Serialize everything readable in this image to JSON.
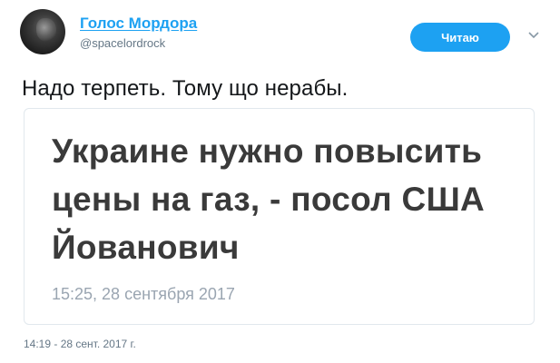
{
  "author": {
    "name": "Голос Мордора",
    "handle": "@spacelordrock"
  },
  "follow_button": {
    "label": "Читаю"
  },
  "tweet": {
    "text": "Надо терпеть. Тому що нерабы.",
    "timestamp": "14:19 - 28 сент. 2017 г."
  },
  "card": {
    "title_lines": [
      "Украине нужно повысить",
      "цены на газ, - посол США",
      "Йованович"
    ],
    "date": "15:25, 28 сентября 2017"
  },
  "colors": {
    "accent": "#1da1f2",
    "text": "#14171a",
    "muted": "#657786"
  },
  "icons": {
    "menu": "chevron-down-icon"
  }
}
